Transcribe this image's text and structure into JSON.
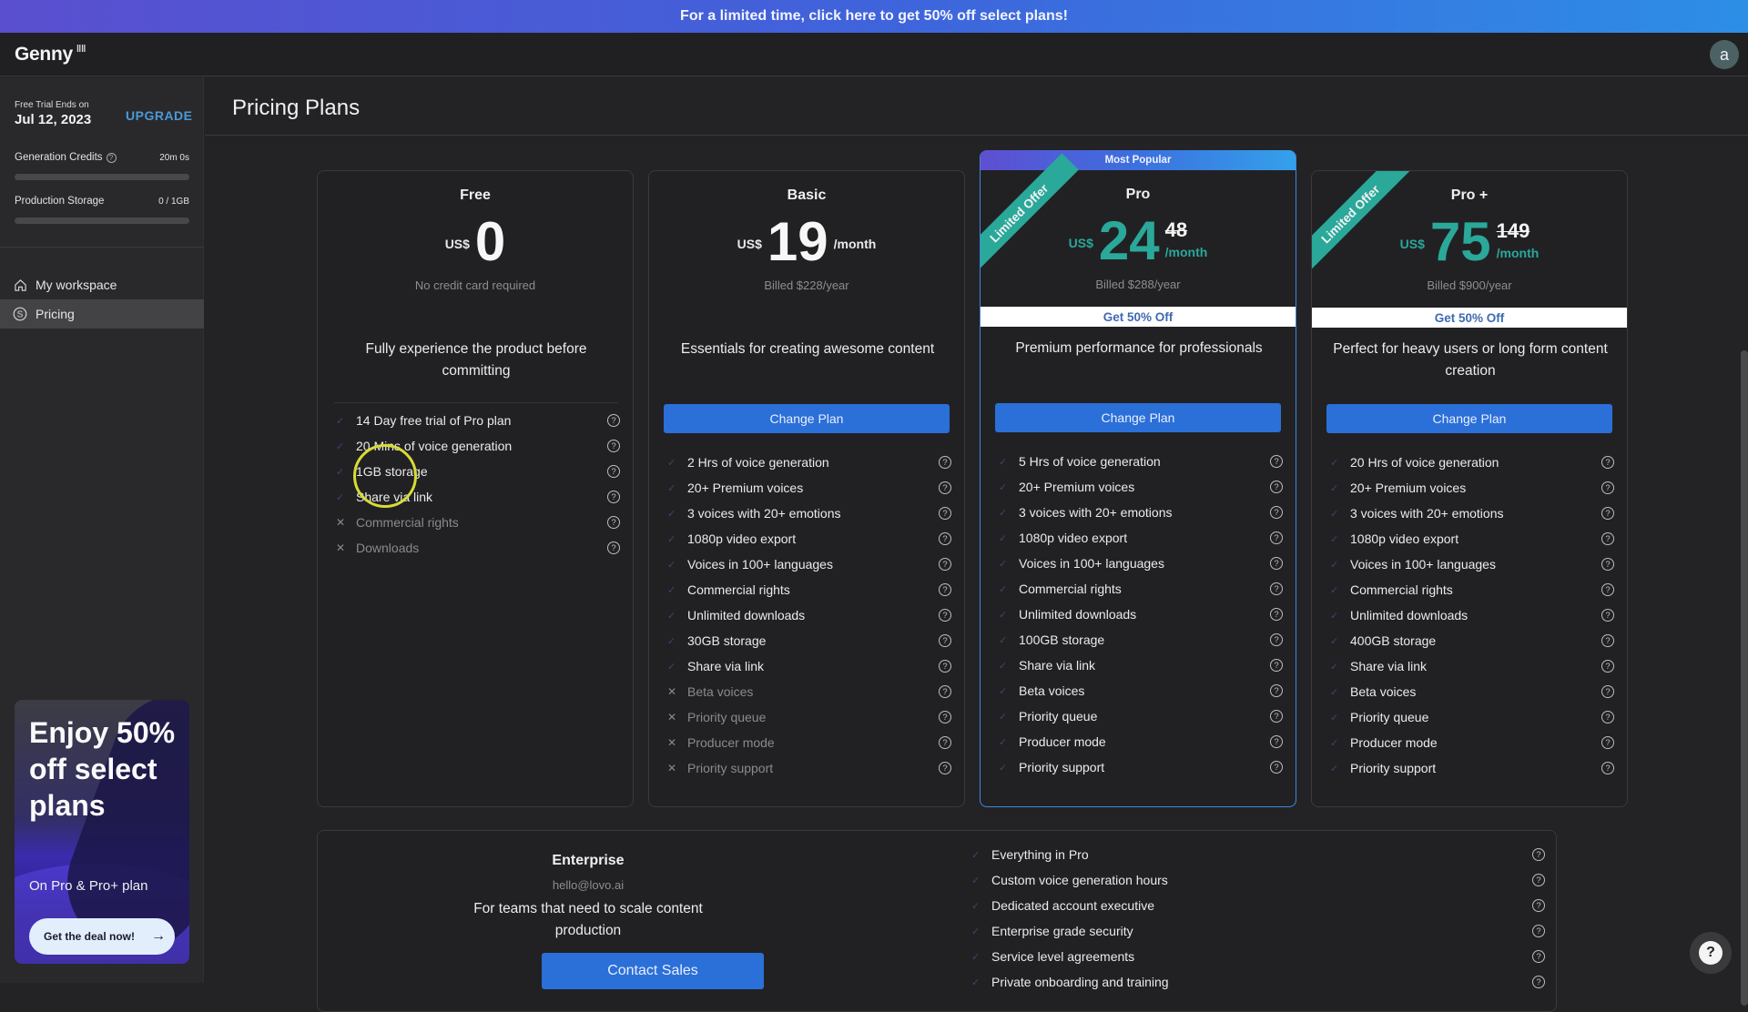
{
  "banner": {
    "text": "For a limited time, click here to get 50% off select plans!"
  },
  "header": {
    "logo": "Genny",
    "logo_mark": "‖‖",
    "avatar_letter": "a"
  },
  "sidebar": {
    "trial_label": "Free Trial Ends on",
    "trial_date": "Jul 12, 2023",
    "upgrade_label": "UPGRADE",
    "credits": {
      "label": "Generation Credits",
      "value": "20m 0s",
      "fraction": 0
    },
    "storage": {
      "label": "Production Storage",
      "value": "0 / 1GB",
      "fraction": 0
    },
    "nav": [
      {
        "label": "My workspace",
        "icon": "home-icon"
      },
      {
        "label": "Pricing",
        "icon": "dollar-circle-icon",
        "active": true
      }
    ],
    "promo": {
      "title": "Enjoy 50% off select plans",
      "subtitle": "On Pro & Pro+ plan",
      "button": "Get the deal now!",
      "button_icon": "→"
    }
  },
  "main": {
    "title": "Pricing Plans",
    "plans": [
      {
        "name": "Free",
        "currency": "US$",
        "amount": "0",
        "period": "",
        "original": "",
        "billing": "No credit card required",
        "tagline": "Fully experience the product before committing",
        "button": "",
        "features": [
          {
            "text": "14 Day free trial of Pro plan",
            "included": true
          },
          {
            "text": "20 Mins of voice generation",
            "included": true
          },
          {
            "text": "1GB storage",
            "included": true
          },
          {
            "text": "Share via link",
            "included": true
          },
          {
            "text": "Commercial rights",
            "included": false
          },
          {
            "text": "Downloads",
            "included": false
          }
        ]
      },
      {
        "name": "Basic",
        "currency": "US$",
        "amount": "19",
        "period": "/month",
        "original": "",
        "billing": "Billed $228/year",
        "tagline": "Essentials for creating awesome content",
        "button": "Change Plan",
        "features": [
          {
            "text": "2 Hrs of voice generation",
            "included": true
          },
          {
            "text": "20+ Premium voices",
            "included": true
          },
          {
            "text": "3 voices with 20+ emotions",
            "included": true
          },
          {
            "text": "1080p video export",
            "included": true
          },
          {
            "text": "Voices in 100+ languages",
            "included": true
          },
          {
            "text": "Commercial rights",
            "included": true
          },
          {
            "text": "Unlimited downloads",
            "included": true
          },
          {
            "text": "30GB storage",
            "included": true
          },
          {
            "text": "Share via link",
            "included": true
          },
          {
            "text": "Beta voices",
            "included": false
          },
          {
            "text": "Priority queue",
            "included": false
          },
          {
            "text": "Producer mode",
            "included": false
          },
          {
            "text": "Priority support",
            "included": false
          }
        ]
      },
      {
        "name": "Pro",
        "badge": "Most Popular",
        "ribbon": "Limited Offer",
        "currency": "US$",
        "amount": "24",
        "period": "/month",
        "original": "48",
        "billing": "Billed $288/year",
        "discount_label": "Get 50% Off",
        "tagline": "Premium performance for professionals",
        "button": "Change Plan",
        "features": [
          {
            "text": "5 Hrs of voice generation",
            "included": true
          },
          {
            "text": "20+ Premium voices",
            "included": true
          },
          {
            "text": "3 voices with 20+ emotions",
            "included": true
          },
          {
            "text": "1080p video export",
            "included": true
          },
          {
            "text": "Voices in 100+ languages",
            "included": true
          },
          {
            "text": "Commercial rights",
            "included": true
          },
          {
            "text": "Unlimited downloads",
            "included": true
          },
          {
            "text": "100GB storage",
            "included": true
          },
          {
            "text": "Share via link",
            "included": true
          },
          {
            "text": "Beta voices",
            "included": true
          },
          {
            "text": "Priority queue",
            "included": true
          },
          {
            "text": "Producer mode",
            "included": true
          },
          {
            "text": "Priority support",
            "included": true
          }
        ]
      },
      {
        "name": "Pro +",
        "ribbon": "Limited Offer",
        "currency": "US$",
        "amount": "75",
        "period": "/month",
        "original": "149",
        "billing": "Billed $900/year",
        "discount_label": "Get 50% Off",
        "tagline": "Perfect for heavy users or long form content creation",
        "button": "Change Plan",
        "features": [
          {
            "text": "20 Hrs of voice generation",
            "included": true
          },
          {
            "text": "20+ Premium voices",
            "included": true
          },
          {
            "text": "3 voices with 20+ emotions",
            "included": true
          },
          {
            "text": "1080p video export",
            "included": true
          },
          {
            "text": "Voices in 100+ languages",
            "included": true
          },
          {
            "text": "Commercial rights",
            "included": true
          },
          {
            "text": "Unlimited downloads",
            "included": true
          },
          {
            "text": "400GB storage",
            "included": true
          },
          {
            "text": "Share via link",
            "included": true
          },
          {
            "text": "Beta voices",
            "included": true
          },
          {
            "text": "Priority queue",
            "included": true
          },
          {
            "text": "Producer mode",
            "included": true
          },
          {
            "text": "Priority support",
            "included": true
          }
        ]
      }
    ],
    "enterprise": {
      "name": "Enterprise",
      "email": "hello@lovo.ai",
      "tagline": "For teams that need to scale content production",
      "button": "Contact Sales",
      "features": [
        "Everything in Pro",
        "Custom voice generation hours",
        "Dedicated account executive",
        "Enterprise grade security",
        "Service level agreements",
        "Private onboarding and training"
      ]
    }
  },
  "icons": {
    "check": "✓",
    "cross": "✕",
    "help": "?"
  },
  "colors": {
    "accent": "#2b6fd8",
    "discount": "#2aa89a",
    "upgrade": "#4a9ad8"
  }
}
